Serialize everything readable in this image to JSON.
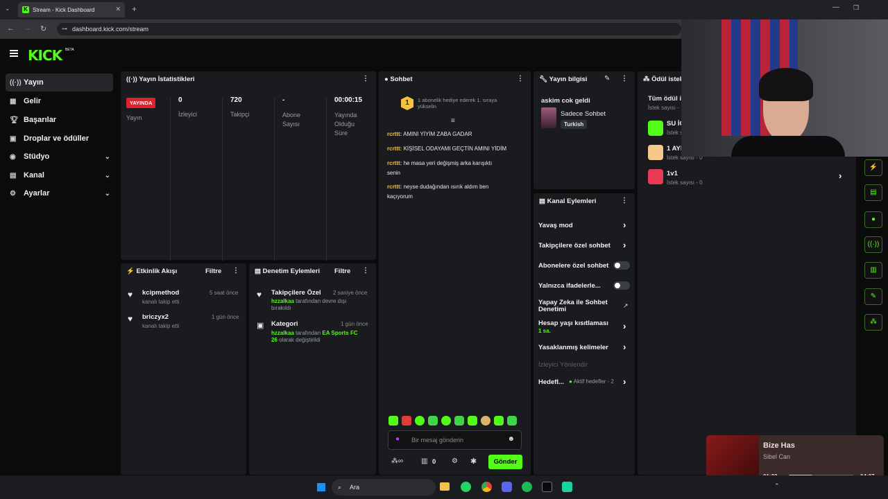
{
  "browser": {
    "tab_title": "Stream - Kick Dashboard",
    "url": "dashboard.kick.com/stream"
  },
  "brand": {
    "logo": "KICK",
    "beta": "BETA",
    "accent": "#53fc18"
  },
  "sidebar": {
    "items": [
      {
        "label": "Yayın",
        "icon": "broadcast-icon"
      },
      {
        "label": "Gelir",
        "icon": "revenue-icon"
      },
      {
        "label": "Başarılar",
        "icon": "trophy-icon"
      },
      {
        "label": "Droplar ve ödüller",
        "icon": "gift-icon"
      },
      {
        "label": "Stüdyo",
        "icon": "studio-icon"
      },
      {
        "label": "Kanal",
        "icon": "channel-icon"
      },
      {
        "label": "Ayarlar",
        "icon": "settings-icon"
      }
    ]
  },
  "stats": {
    "title": "Yayın İstatistikleri",
    "live_badge": "YAYINDA",
    "live_label": "Yayın",
    "viewers_value": "0",
    "viewers_label": "İzleyici",
    "followers_value": "720",
    "followers_label": "Takipçi",
    "subs_value": "-",
    "subs_label_1": "Abone",
    "subs_label_2": "Sayısı",
    "uptime_value": "00:00:15",
    "uptime_label_1": "Yayında",
    "uptime_label_2": "Olduğu",
    "uptime_label_3": "Süre"
  },
  "chat": {
    "title": "Sohbet",
    "pinned_rank": "1",
    "pinned_line1": "1 abonelik hediye ederek 1. sıraya",
    "pinned_line2": "yükselin",
    "messages": [
      {
        "user": "rcrttt:",
        "text1": "AMINI YİYİM ZABA GADAR",
        "text2": ""
      },
      {
        "user": "rcrttt:",
        "text1": "KİŞİSEL ODAYAMI GEÇTİN AMINI YİDİM",
        "text2": ""
      },
      {
        "user": "rcrttt:",
        "text1": "he masa yeri değişmiş arka karışıktı",
        "text2": "senin"
      },
      {
        "user": "rcrttt:",
        "text1": "neyse dudağından ısırık aldım ben",
        "text2": "kaçıyorum"
      }
    ],
    "input_placeholder": "Bir mesaj gönderin",
    "points": "0",
    "send_label": "Gönder"
  },
  "stream_info": {
    "title": "Yayın bilgisi",
    "stream_title": "askim cok geldi",
    "category": "Sadece Sohbet",
    "tag": "Turkish"
  },
  "channel_actions": {
    "title": "Kanal Eylemleri",
    "rows": {
      "slow": "Yavaş mod",
      "followers": "Takipçilere özel sohbet",
      "subs": "Abonelere özel sohbet",
      "emotes": "Yalnızca ifadelerle...",
      "ai_1": "Yapay Zeka ile Sohbet",
      "ai_2": "Denetimi",
      "age": "Hesap yaşı kısıtlaması",
      "age_sub": "1 sa.",
      "banned": "Yasaklanmış kelimeler",
      "raid": "İzleyici Yönlendir",
      "goals": "Hedefl...",
      "goals_sub": "Aktif hedefler - 2"
    }
  },
  "rewards": {
    "title": "Ödül istek",
    "all_title": "Tüm ödül is",
    "all_sub": "İstek sayısı - ",
    "items": [
      {
        "name": "SU İÇ",
        "sub": "İstek s",
        "color": "#53fc18"
      },
      {
        "name": "1 AYI",
        "sub": "İstek sayısı - 0",
        "color": "#f5c88b"
      },
      {
        "name": "1v1",
        "sub": "İstek sayısı - 0",
        "color": "#e83a55"
      }
    ]
  },
  "activity": {
    "title": "Etkinlik Akışı",
    "filter": "Filtre",
    "events": [
      {
        "user": "kcipmethod",
        "desc": "kanalı takip etti",
        "time": "5 saat önce"
      },
      {
        "user": "briczyx2",
        "desc": "kanalı takip etti",
        "time": "1 gün önce"
      }
    ]
  },
  "moderation": {
    "title": "Denetim Eylemleri",
    "filter": "Filtre",
    "events": [
      {
        "title": "Takipçilere Özel",
        "time": "2 saniye önce",
        "user": "hzzalkaa",
        "desc1": " tarafından devre dışı",
        "desc2": "bırakıldı"
      },
      {
        "title": "Kategori",
        "time": "1 gün önce",
        "user": "hzzalkaa",
        "desc1": " tarafından ",
        "hl": "EA Sports FC",
        "hl2": "26",
        "desc2": " olarak değiştirildi"
      }
    ]
  },
  "music": {
    "song": "Bize Has",
    "artist": "Sibel Can",
    "elapsed": "01:33",
    "total": "04:07",
    "progress": 0.38
  },
  "taskbar": {
    "search": "Ara"
  }
}
